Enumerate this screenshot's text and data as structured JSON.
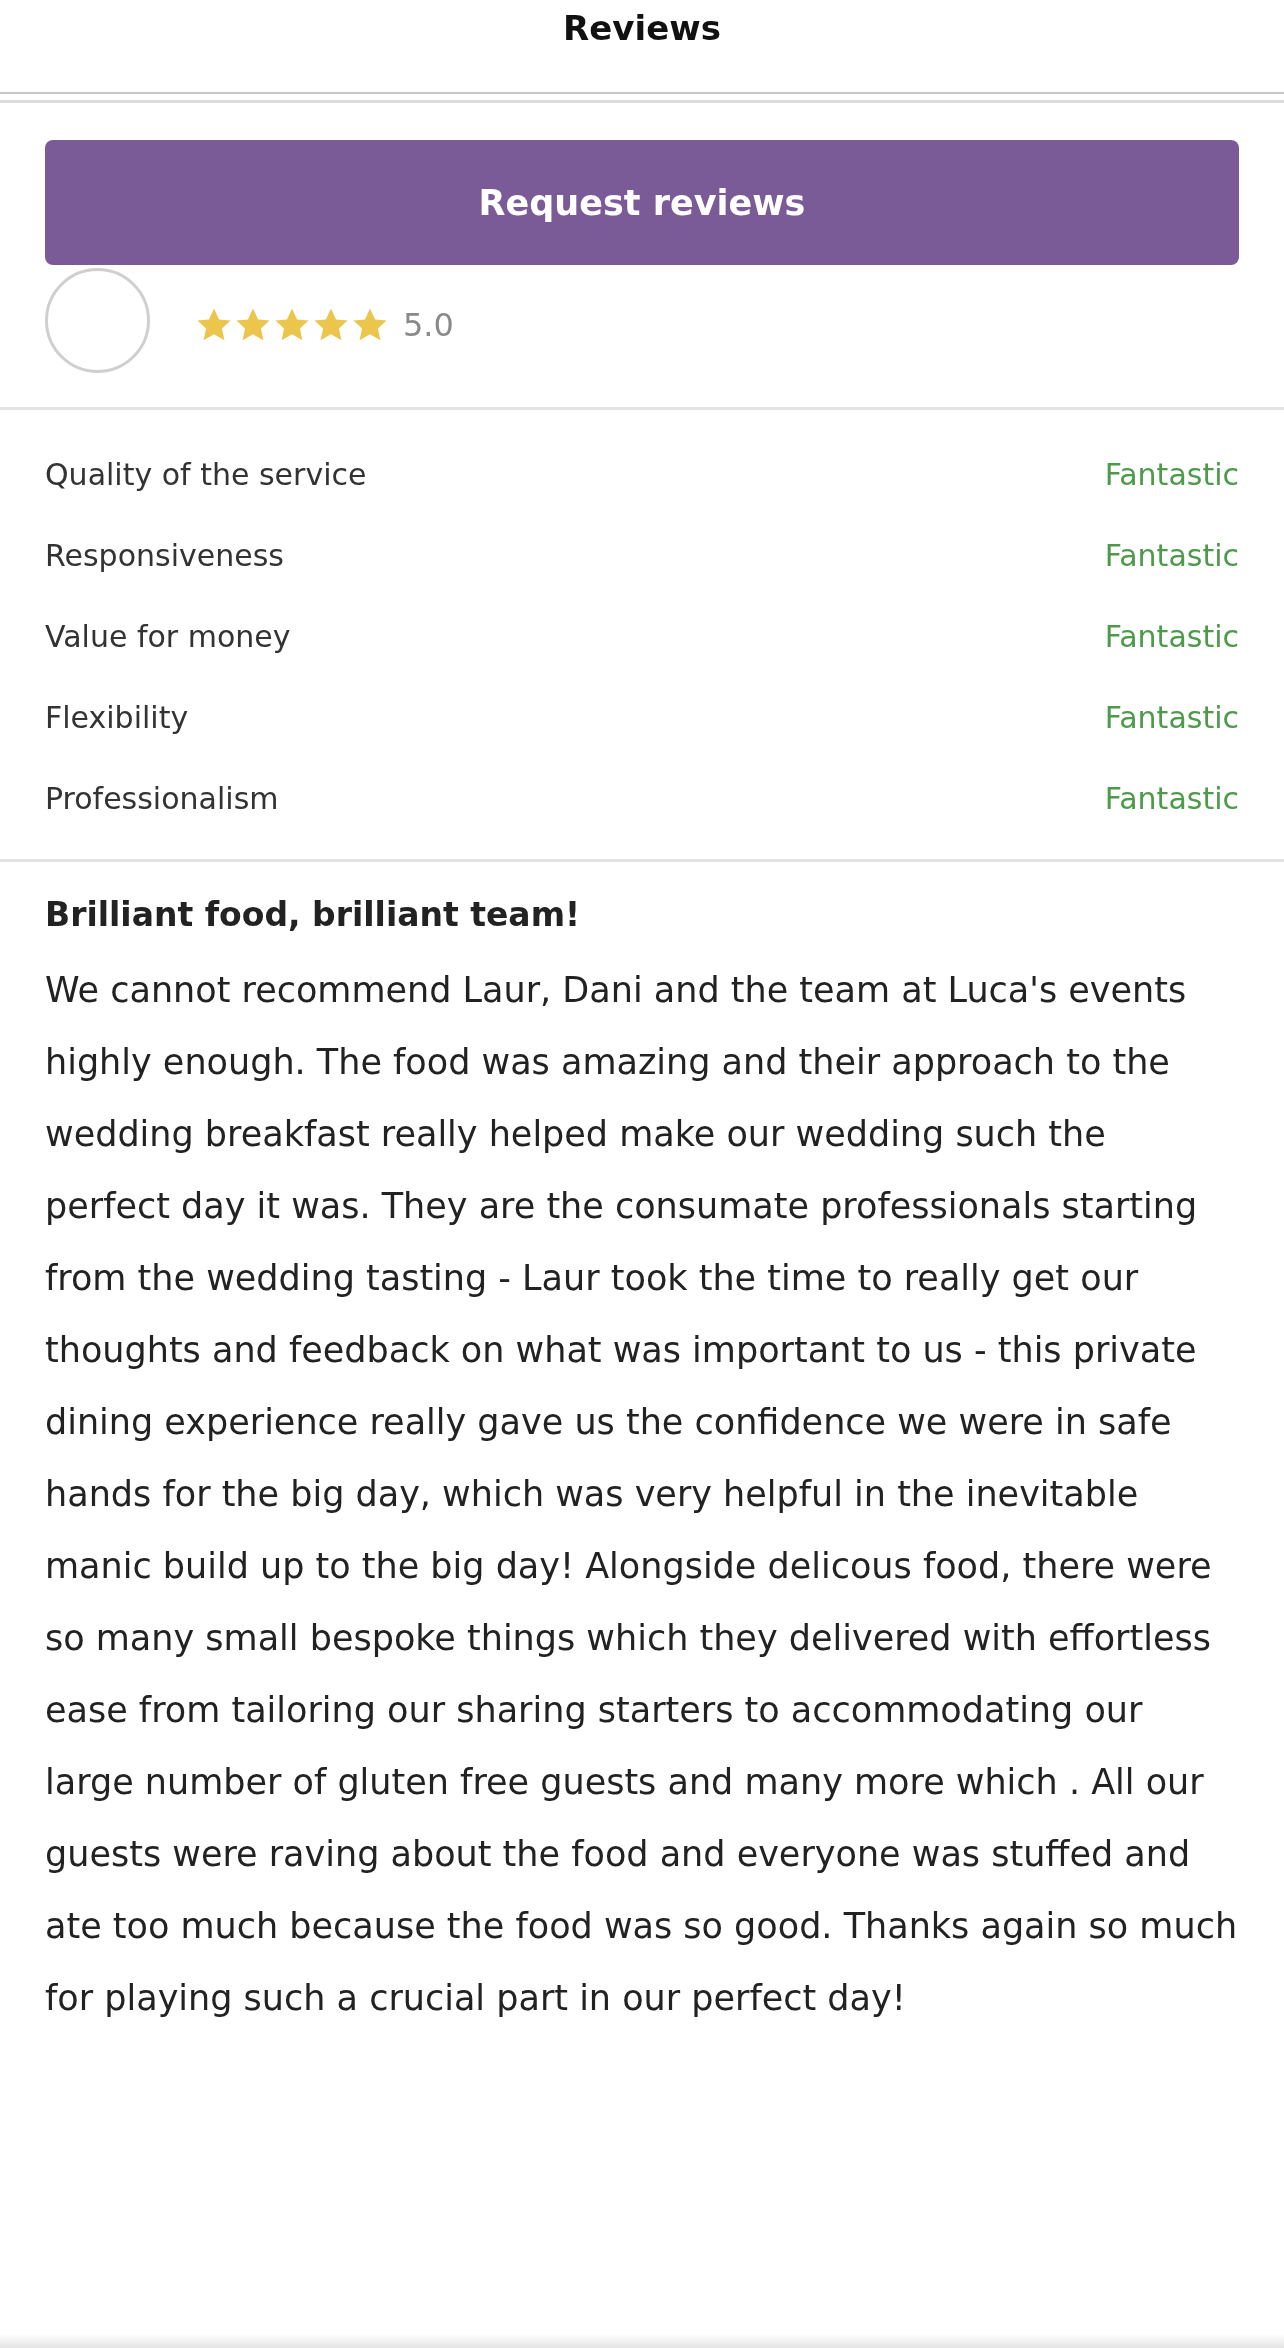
{
  "header": {
    "title": "Reviews"
  },
  "request_button": {
    "label": "Request reviews"
  },
  "reviewer": {
    "stars": 5,
    "score": "5.0"
  },
  "ratings": [
    {
      "label": "Quality of the service",
      "value": "Fantastic"
    },
    {
      "label": "Responsiveness",
      "value": "Fantastic"
    },
    {
      "label": "Value for money",
      "value": "Fantastic"
    },
    {
      "label": "Flexibility",
      "value": "Fantastic"
    },
    {
      "label": "Professionalism",
      "value": "Fantastic"
    }
  ],
  "review": {
    "title": "Brilliant food, brilliant team!",
    "body": "We cannot recommend Laur, Dani and the team at Luca's events highly enough. The food was amazing and their approach to the wedding breakfast really helped make our wedding such the perfect day it was. They are the consumate professionals starting from the wedding tasting - Laur took the time to really get our thoughts and feedback on what was important to us - this private dining experience really gave us the confidence we were in safe hands for the big day, which was very helpful in the inevitable manic build up to the big day! Alongside delicous food, there were so many small bespoke things which they delivered with effortless ease from tailoring our sharing starters to accommodating our large number of gluten free guests and many more which . All our guests were raving about the food and everyone was stuffed and ate too much because the food was so good. Thanks again so much for playing such a crucial part in our perfect day!"
  }
}
